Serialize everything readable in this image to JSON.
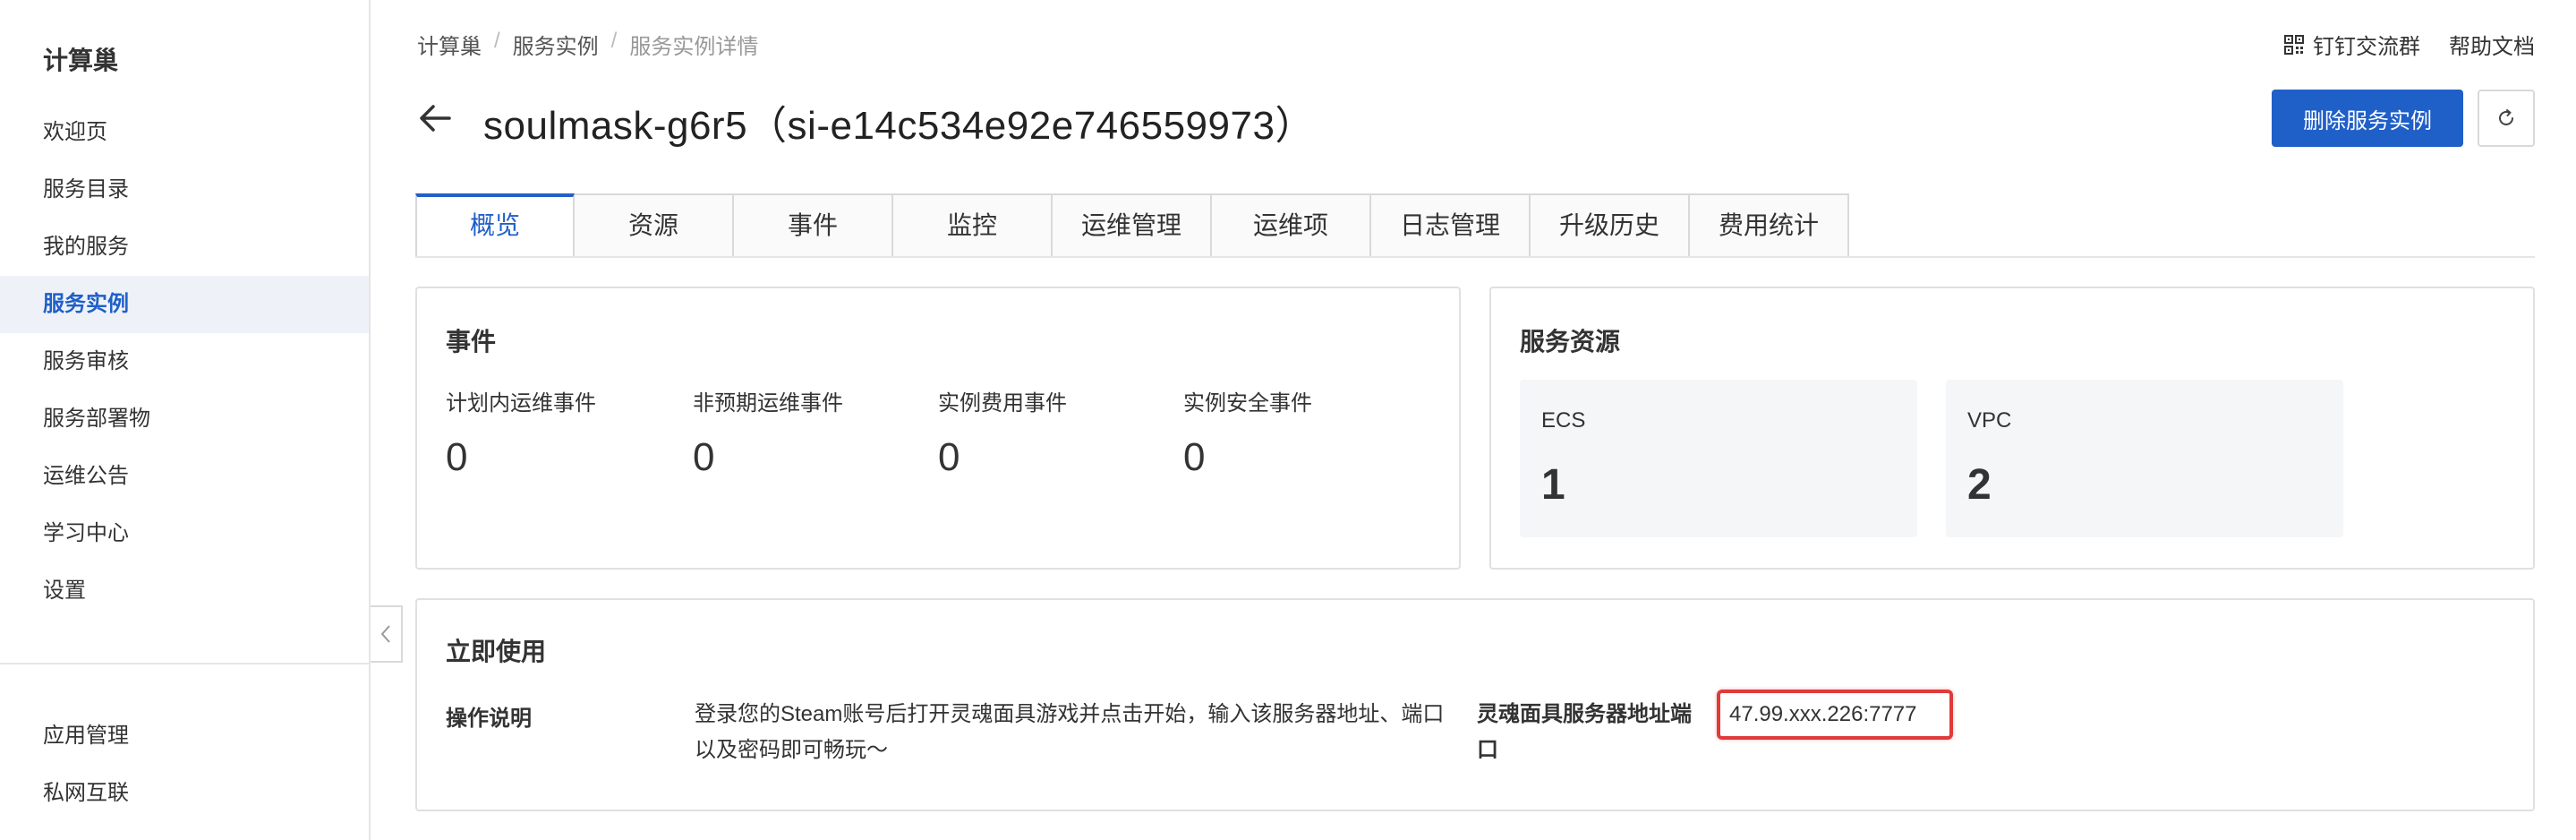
{
  "sidebar": {
    "title": "计算巢",
    "items": [
      {
        "label": "欢迎页"
      },
      {
        "label": "服务目录"
      },
      {
        "label": "我的服务"
      },
      {
        "label": "服务实例"
      },
      {
        "label": "服务审核"
      },
      {
        "label": "服务部署物"
      },
      {
        "label": "运维公告"
      },
      {
        "label": "学习中心"
      },
      {
        "label": "设置"
      }
    ],
    "bottom_items": [
      {
        "label": "应用管理"
      },
      {
        "label": "私网互联"
      }
    ]
  },
  "breadcrumb": {
    "items": [
      "计算巢",
      "服务实例",
      "服务实例详情"
    ],
    "separator": "/"
  },
  "top_links": {
    "dingtalk": "钉钉交流群",
    "help": "帮助文档"
  },
  "header": {
    "title": "soulmask-g6r5（si-e14c534e92e746559973）",
    "delete_button": "删除服务实例"
  },
  "tabs": [
    "概览",
    "资源",
    "事件",
    "监控",
    "运维管理",
    "运维项",
    "日志管理",
    "升级历史",
    "费用统计"
  ],
  "events_card": {
    "title": "事件",
    "items": [
      {
        "label": "计划内运维事件",
        "value": "0"
      },
      {
        "label": "非预期运维事件",
        "value": "0"
      },
      {
        "label": "实例费用事件",
        "value": "0"
      },
      {
        "label": "实例安全事件",
        "value": "0"
      }
    ]
  },
  "resources_card": {
    "title": "服务资源",
    "items": [
      {
        "label": "ECS",
        "value": "1"
      },
      {
        "label": "VPC",
        "value": "2"
      }
    ]
  },
  "usage_card": {
    "title": "立即使用",
    "op_label": "操作说明",
    "op_desc": "登录您的Steam账号后打开灵魂面具游戏并点击开始，输入该服务器地址、端口以及密码即可畅玩～",
    "addr_label": "灵魂面具服务器地址端口",
    "addr_value": "47.99.xxx.226:7777"
  },
  "colors": {
    "accent": "#1f5fc8",
    "highlight": "#e03a3a",
    "sidebar_active_bg": "#eef2f8"
  }
}
